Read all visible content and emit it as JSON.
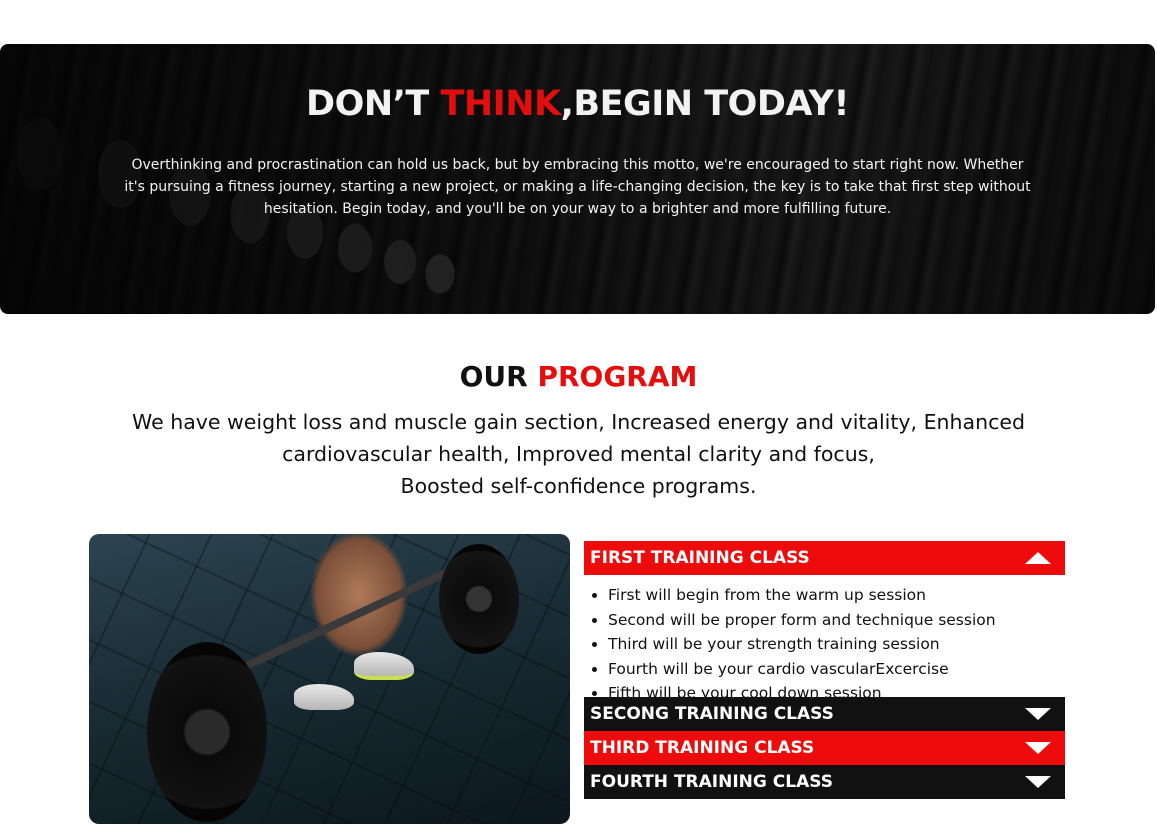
{
  "hero": {
    "title_part1": "DON’T ",
    "title_highlight": "THINK",
    "title_part2": ",BEGIN TODAY!",
    "text": "Overthinking and procrastination can hold us back, but by embracing this motto, we're encouraged to start right now. Whether it's pursuing a fitness journey, starting a new project, or making a life-changing decision, the key is to take that first step without hesitation. Begin today, and you'll be on your way to a brighter and more fulfilling future."
  },
  "program": {
    "title_part1": "OUR ",
    "title_highlight": "PROGRAM",
    "desc_line1": "We have weight loss and muscle gain section, Increased energy and vitality, Enhanced",
    "desc_line2": "cardiovascular health, Improved mental clarity and focus,",
    "desc_line3": "Boosted self-confidence programs."
  },
  "accordion": {
    "items": [
      {
        "label": "FIRST TRAINING CLASS",
        "expanded": true,
        "bullets": [
          "First will begin from the warm up session",
          "Second will be proper form and technique session",
          "Third will be your strength training session",
          "Fourth will be your cardio vascularExcercise",
          "Fifth will be your cool down session"
        ]
      },
      {
        "label": "SECONG TRAINING CLASS",
        "expanded": false
      },
      {
        "label": "THIRD TRAINING CLASS",
        "expanded": false
      },
      {
        "label": "FOURTH TRAINING CLASS",
        "expanded": false
      }
    ]
  },
  "colors": {
    "accent_red": "#ee0b0b",
    "dark": "#111111"
  },
  "icons": {
    "expanded": "triangle-up-icon",
    "collapsed": "triangle-down-icon"
  }
}
